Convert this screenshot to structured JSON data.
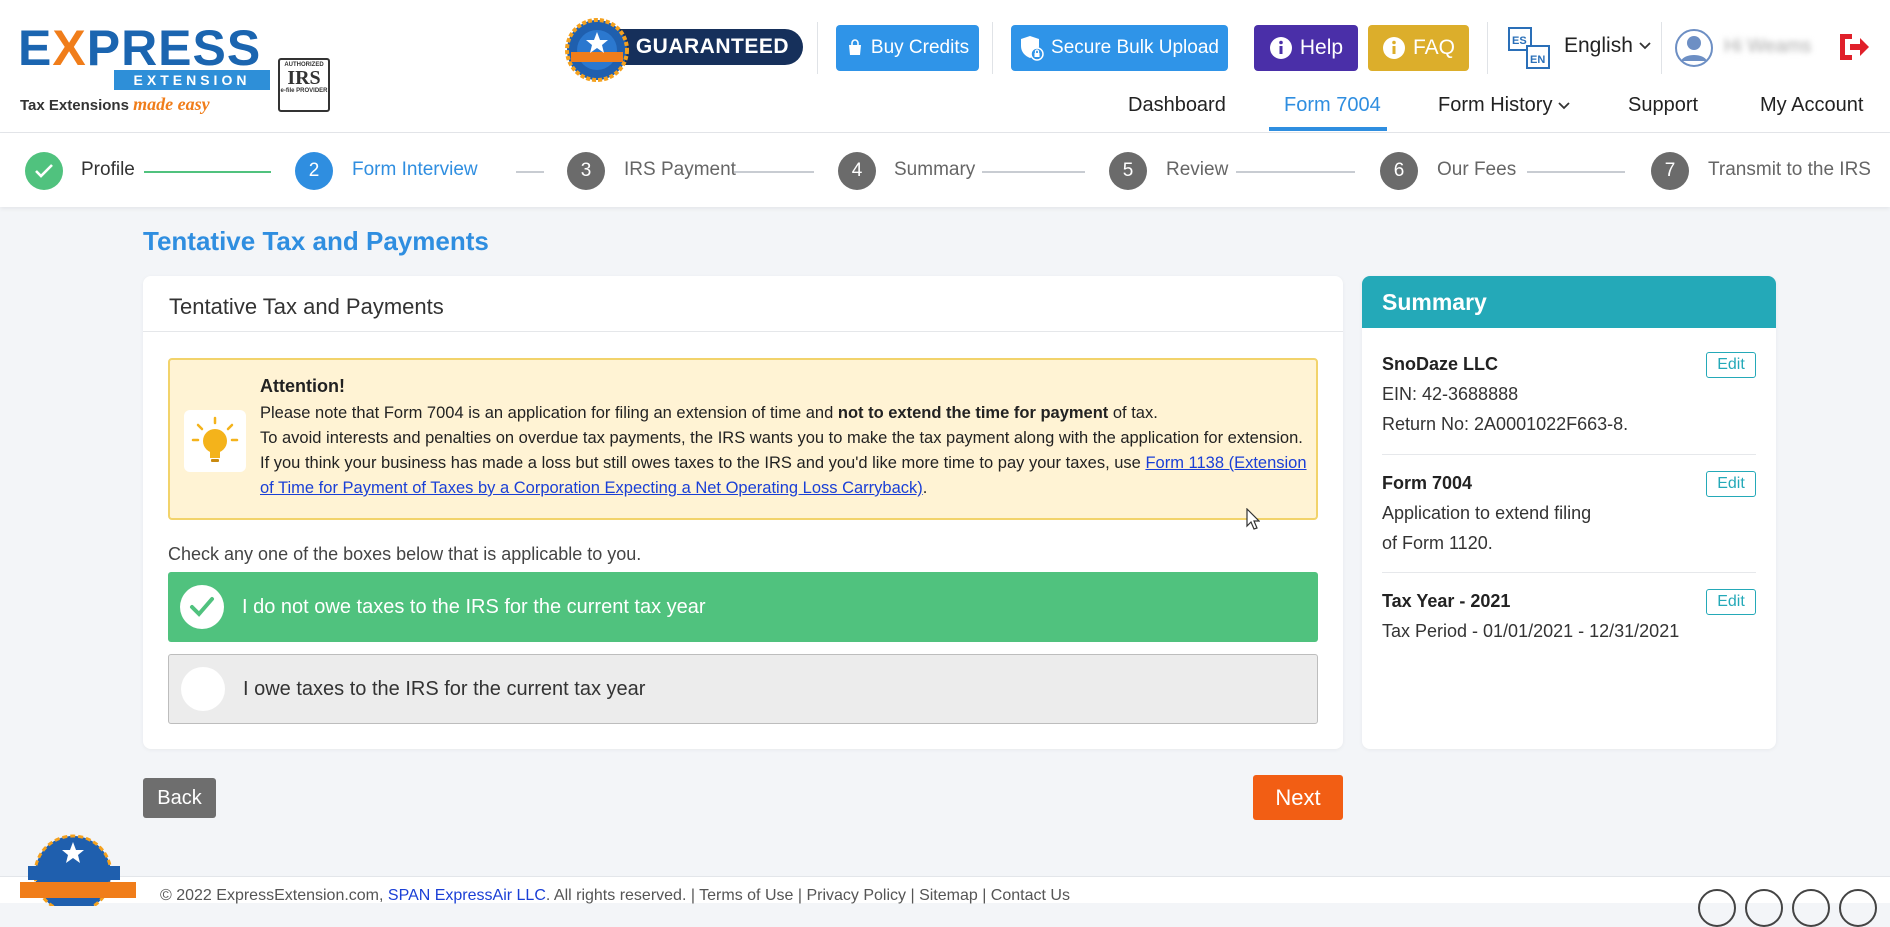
{
  "header": {
    "logo_word": "EXPRESS",
    "logo_sub": "EXTENSION",
    "logo_tagline": "Tax Extensions",
    "logo_tagline_script": "made easy",
    "irs_badge": {
      "top": "AUTHORIZED",
      "main": "IRS",
      "bottom": "e-file PROVIDER"
    },
    "guaranteed": "GUARANTEED",
    "buy_credits": "Buy Credits",
    "secure_bulk_upload": "Secure Bulk Upload",
    "help": "Help",
    "faq": "FAQ",
    "lang_icon": {
      "top": "ES",
      "bottom": "EN"
    },
    "language": "English",
    "user_name": "Hi Weams"
  },
  "nav": {
    "dashboard": "Dashboard",
    "form7004": "Form 7004",
    "form_history": "Form History",
    "support": "Support",
    "my_account": "My Account"
  },
  "steps": [
    {
      "num": "✓",
      "label": "Profile",
      "state": "done"
    },
    {
      "num": "2",
      "label": "Form Interview",
      "state": "active"
    },
    {
      "num": "3",
      "label": "IRS Payment",
      "state": "todo"
    },
    {
      "num": "4",
      "label": "Summary",
      "state": "todo"
    },
    {
      "num": "5",
      "label": "Review",
      "state": "todo"
    },
    {
      "num": "6",
      "label": "Our Fees",
      "state": "todo"
    },
    {
      "num": "7",
      "label": "Transmit to the IRS",
      "state": "todo"
    }
  ],
  "page": {
    "title": "Tentative Tax and Payments",
    "card_title": "Tentative Tax and Payments",
    "attention": {
      "title": "Attention!",
      "line1_a": "Please note that Form 7004 is an application for filing an extension of time and ",
      "line1_b": "not to extend the time for payment",
      "line1_c": " of tax.",
      "line2": "To avoid interests and penalties on overdue tax payments, the IRS wants you to make the tax payment along with the application for extension.",
      "line3_a": "If you think your business has made a loss but still owes taxes to the IRS and you'd like more time to pay your taxes, use ",
      "line3_link": "Form 1138 (Extension of Time for Payment of Taxes by a Corporation Expecting a Net Operating Loss Carryback)",
      "line3_c": "."
    },
    "check_prompt": "Check any one of the boxes below that is applicable to you.",
    "option_no_owe": "I do not owe taxes to the IRS for the current tax year",
    "option_owe": "I owe taxes to the IRS for the current tax year",
    "selected": "no_owe",
    "back": "Back",
    "next": "Next"
  },
  "summary": {
    "title": "Summary",
    "edit": "Edit",
    "business": {
      "name": "SnoDaze LLC",
      "ein": "EIN: 42-3688888",
      "return_no": "Return No: 2A0001022F663-8."
    },
    "form": {
      "name": "Form 7004",
      "line1": "Application to extend filing",
      "line2": "of Form 1120."
    },
    "tax_year": {
      "name": "Tax Year - 2021",
      "period": "Tax Period - 01/01/2021 - 12/31/2021"
    }
  },
  "footer": {
    "text_a": "© 2022 ExpressExtension.com, ",
    "text_link": "SPAN ExpressAir LLC",
    "text_b": ". All rights reserved. | Terms of Use | Privacy Policy | Sitemap | Contact Us"
  },
  "colors": {
    "accent": "#2f8ee0",
    "success": "#50c27e",
    "teal": "#24a9b8",
    "next": "#f25e14",
    "help": "#4a2fa8",
    "faq": "#dcae2b"
  }
}
